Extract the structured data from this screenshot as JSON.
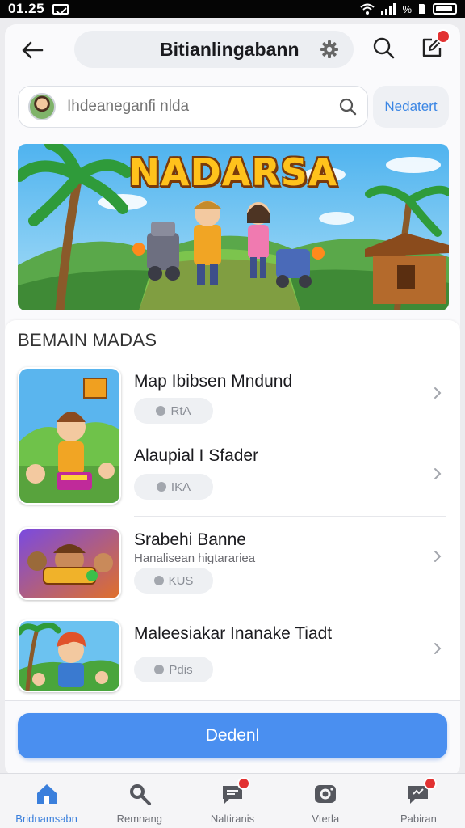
{
  "status_bar": {
    "time": "01.25",
    "battery_text": "%"
  },
  "header": {
    "title": "Bitianlingabann"
  },
  "search": {
    "placeholder": "Ihdeaneganfi nlda",
    "next_label": "Nedatert"
  },
  "banner": {
    "title": "NADARSA"
  },
  "section": {
    "title": "BEMAIN MADAS"
  },
  "games": [
    {
      "title": "Map Ibibsen Mndund",
      "tag": "RtA"
    },
    {
      "title": "Alaupial I Sfader",
      "tag": "IKA"
    },
    {
      "title": "Srabehi Banne",
      "subtitle": "Hanalisean higtarariea",
      "tag": "KUS"
    },
    {
      "title": "Maleesiakar Inanake Tiadt",
      "tag": "Pdis"
    }
  ],
  "primary_button": {
    "label": "Dedenl"
  },
  "bottom_nav": [
    {
      "label": "Bridnamsabn",
      "icon": "home-icon",
      "active": true
    },
    {
      "label": "Remnang",
      "icon": "search-icon",
      "active": false
    },
    {
      "label": "Naltiranis",
      "icon": "message-icon",
      "badge": true,
      "active": false
    },
    {
      "label": "Vterla",
      "icon": "camera-icon",
      "active": false
    },
    {
      "label": "Pabiran",
      "icon": "chat-icon",
      "badge": true,
      "active": false
    }
  ],
  "colors": {
    "accent": "#4a8ff0",
    "badge": "#e23232",
    "link": "#3b86e4"
  }
}
